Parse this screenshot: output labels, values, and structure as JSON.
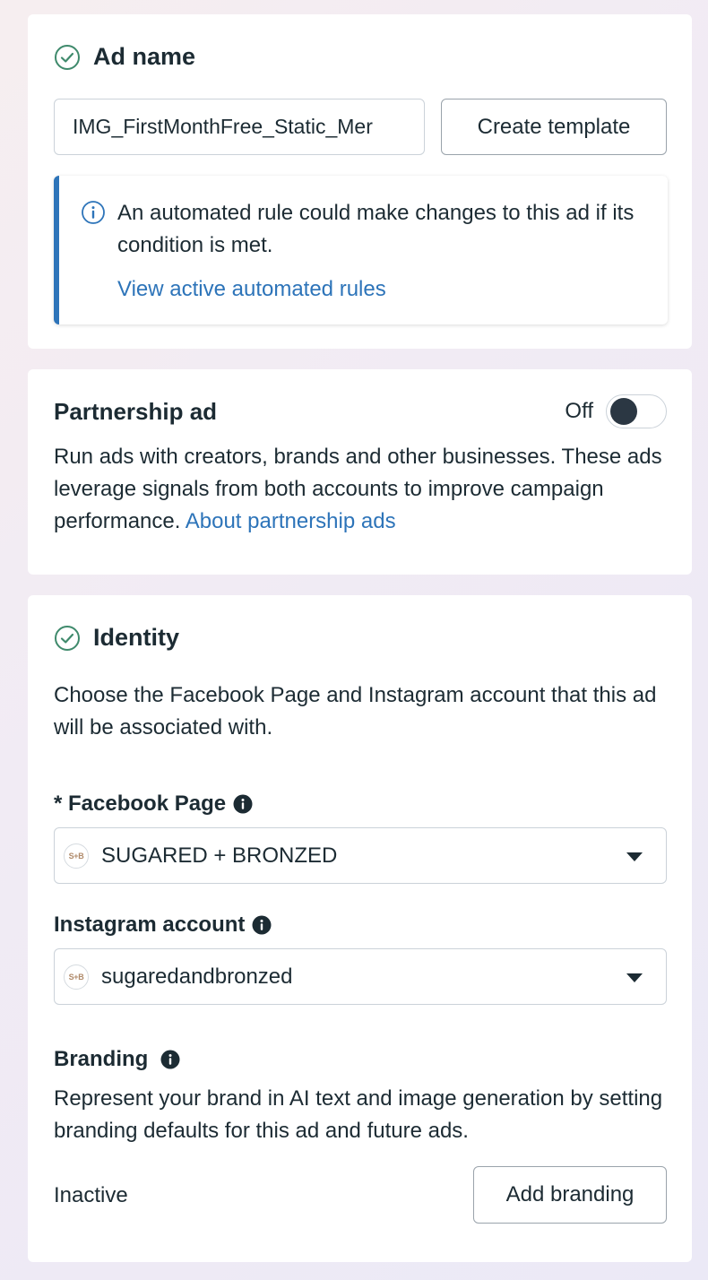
{
  "ad_name": {
    "title": "Ad name",
    "input_value": "IMG_FirstMonthFree_Static_Mer",
    "create_template_label": "Create template",
    "notice": {
      "message": "An automated rule could make changes to this ad if its condition is met.",
      "link": "View active automated rules"
    }
  },
  "partnership": {
    "title": "Partnership ad",
    "toggle_state": "Off",
    "toggle_on": false,
    "description": "Run ads with creators, brands and other businesses. These ads leverage signals from both accounts to improve campaign performance.",
    "link": "About partnership ads"
  },
  "identity": {
    "title": "Identity",
    "description": "Choose the Facebook Page and Instagram account that this ad will be associated with.",
    "facebook_page": {
      "label": "* Facebook Page",
      "value": "SUGARED + BRONZED",
      "avatar_text": "S+B"
    },
    "instagram": {
      "label": "Instagram account",
      "value": "sugaredandbronzed",
      "avatar_text": "S+B"
    },
    "branding": {
      "label": "Branding",
      "description": "Represent your brand in AI text and image generation by setting branding defaults for this ad and future ads.",
      "status": "Inactive",
      "button_label": "Add branding"
    }
  },
  "colors": {
    "link": "#2d74b9",
    "success": "#3f8a6c",
    "text": "#1c2b33"
  }
}
